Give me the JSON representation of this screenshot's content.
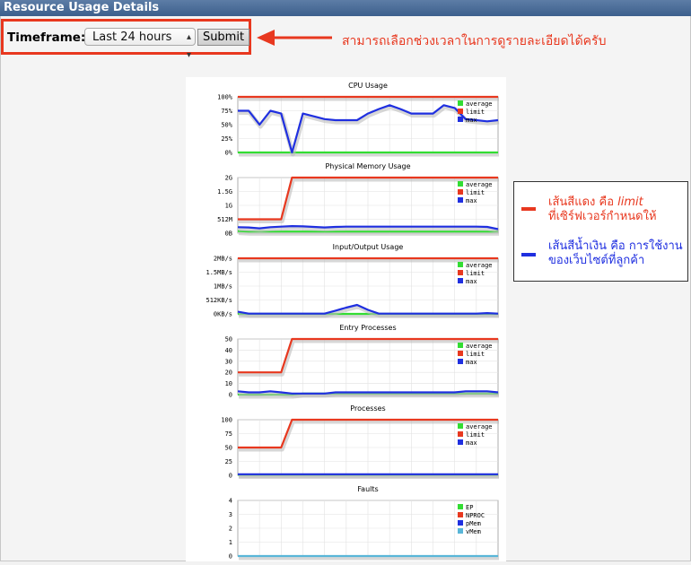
{
  "title": "Resource Usage Details",
  "timeframe": {
    "label": "Timeframe:",
    "selected": "Last 24 hours",
    "submit_label": "Submit"
  },
  "annotations": {
    "top_note": "สามารถเลือกช่วงเวลาในการดูรายละเอียดได้ครับ",
    "legend_red_line1_prefix": "เส้นสีแดง คือ ",
    "legend_red_line1_em": "limit",
    "legend_red_line2": "ที่เซิร์ฟเวอร์กำหนดให้",
    "legend_blue_line1": "เส้นสีน้ำเงิน คือ การใช้งาน",
    "legend_blue_line2": "ของเว็บไซต์ที่ลูกค้า",
    "red_color": "#e8381f",
    "blue_color": "#1f2fe0"
  },
  "chart_data": [
    {
      "type": "line",
      "title": "CPU Usage",
      "yticks": [
        "100%",
        "75%",
        "50%",
        "25%",
        "0%"
      ],
      "ylim": [
        0,
        100
      ],
      "legend": [
        "average",
        "limit",
        "max"
      ],
      "series": [
        {
          "name": "average",
          "color": "#33dd33",
          "values": [
            0,
            0,
            0,
            0,
            0,
            0,
            0,
            0,
            0,
            0,
            0,
            0,
            0,
            0,
            0,
            0,
            0,
            0,
            0,
            0,
            0,
            0,
            0,
            0,
            0
          ]
        },
        {
          "name": "limit",
          "color": "#e8381f",
          "values": [
            100,
            100,
            100,
            100,
            100,
            100,
            100,
            100,
            100,
            100,
            100,
            100,
            100,
            100,
            100,
            100,
            100,
            100,
            100,
            100,
            100,
            100,
            100,
            100,
            100
          ]
        },
        {
          "name": "max",
          "color": "#1f2fe0",
          "values": [
            75,
            75,
            50,
            75,
            70,
            0,
            70,
            65,
            60,
            58,
            58,
            58,
            70,
            78,
            85,
            78,
            70,
            70,
            70,
            85,
            80,
            60,
            58,
            56,
            58
          ]
        }
      ]
    },
    {
      "type": "line",
      "title": "Physical Memory Usage",
      "yticks": [
        "2G",
        "1.5G",
        "1G",
        "512M",
        "0B"
      ],
      "ylim": [
        0,
        2048
      ],
      "legend": [
        "average",
        "limit",
        "max"
      ],
      "series": [
        {
          "name": "average",
          "color": "#33dd33",
          "values": [
            80,
            60,
            60,
            60,
            60,
            60,
            60,
            60,
            60,
            60,
            60,
            60,
            60,
            60,
            60,
            60,
            60,
            60,
            60,
            60,
            60,
            60,
            60,
            60,
            60
          ]
        },
        {
          "name": "limit",
          "color": "#e8381f",
          "values": [
            512,
            512,
            512,
            512,
            512,
            2048,
            2048,
            2048,
            2048,
            2048,
            2048,
            2048,
            2048,
            2048,
            2048,
            2048,
            2048,
            2048,
            2048,
            2048,
            2048,
            2048,
            2048,
            2048,
            2048
          ]
        },
        {
          "name": "max",
          "color": "#1f2fe0",
          "values": [
            220,
            210,
            180,
            220,
            240,
            260,
            250,
            230,
            210,
            230,
            240,
            240,
            240,
            240,
            240,
            240,
            240,
            240,
            240,
            240,
            240,
            240,
            240,
            230,
            150
          ]
        }
      ]
    },
    {
      "type": "line",
      "title": "Input/Output Usage",
      "yticks": [
        "2MB/s",
        "1.5MB/s",
        "1MB/s",
        "512KB/s",
        "0KB/s"
      ],
      "ylim": [
        0,
        2048
      ],
      "legend": [
        "average",
        "limit",
        "max"
      ],
      "series": [
        {
          "name": "average",
          "color": "#33dd33",
          "values": [
            0,
            0,
            0,
            0,
            0,
            0,
            0,
            0,
            0,
            0,
            0,
            0,
            0,
            0,
            0,
            0,
            0,
            0,
            0,
            0,
            0,
            0,
            0,
            0,
            0
          ]
        },
        {
          "name": "limit",
          "color": "#e8381f",
          "values": [
            2048,
            2048,
            2048,
            2048,
            2048,
            2048,
            2048,
            2048,
            2048,
            2048,
            2048,
            2048,
            2048,
            2048,
            2048,
            2048,
            2048,
            2048,
            2048,
            2048,
            2048,
            2048,
            2048,
            2048,
            2048
          ]
        },
        {
          "name": "max",
          "color": "#1f2fe0",
          "values": [
            80,
            10,
            10,
            10,
            10,
            10,
            10,
            10,
            10,
            120,
            230,
            330,
            150,
            10,
            10,
            10,
            10,
            10,
            10,
            10,
            10,
            10,
            10,
            30,
            10
          ]
        }
      ]
    },
    {
      "type": "line",
      "title": "Entry Processes",
      "yticks": [
        "50",
        "40",
        "30",
        "20",
        "10",
        "0"
      ],
      "ylim": [
        0,
        50
      ],
      "legend": [
        "average",
        "limit",
        "max"
      ],
      "series": [
        {
          "name": "average",
          "color": "#33dd33",
          "values": [
            0,
            0,
            0,
            0,
            0,
            0,
            1,
            1,
            1,
            1,
            1,
            1,
            1,
            1,
            1,
            1,
            1,
            1,
            1,
            1,
            1,
            1,
            1,
            1,
            1
          ]
        },
        {
          "name": "limit",
          "color": "#e8381f",
          "values": [
            20,
            20,
            20,
            20,
            20,
            50,
            50,
            50,
            50,
            50,
            50,
            50,
            50,
            50,
            50,
            50,
            50,
            50,
            50,
            50,
            50,
            50,
            50,
            50,
            50
          ]
        },
        {
          "name": "max",
          "color": "#1f2fe0",
          "values": [
            3,
            2,
            2,
            3,
            2,
            1,
            1,
            1,
            1,
            2,
            2,
            2,
            2,
            2,
            2,
            2,
            2,
            2,
            2,
            2,
            2,
            3,
            3,
            3,
            2
          ]
        }
      ]
    },
    {
      "type": "line",
      "title": "Processes",
      "yticks": [
        "100",
        "75",
        "50",
        "25",
        "0"
      ],
      "ylim": [
        0,
        100
      ],
      "legend": [
        "average",
        "limit",
        "max"
      ],
      "series": [
        {
          "name": "average",
          "color": "#33dd33",
          "values": [
            1,
            1,
            1,
            1,
            1,
            1,
            1,
            1,
            1,
            1,
            1,
            1,
            1,
            1,
            1,
            1,
            1,
            1,
            1,
            1,
            1,
            1,
            1,
            1,
            1
          ]
        },
        {
          "name": "limit",
          "color": "#e8381f",
          "values": [
            50,
            50,
            50,
            50,
            50,
            100,
            100,
            100,
            100,
            100,
            100,
            100,
            100,
            100,
            100,
            100,
            100,
            100,
            100,
            100,
            100,
            100,
            100,
            100,
            100
          ]
        },
        {
          "name": "max",
          "color": "#1f2fe0",
          "values": [
            2,
            2,
            2,
            2,
            2,
            2,
            2,
            2,
            2,
            2,
            2,
            2,
            2,
            2,
            2,
            2,
            2,
            2,
            2,
            2,
            2,
            2,
            2,
            2,
            2
          ]
        }
      ]
    },
    {
      "type": "line",
      "title": "Faults",
      "yticks": [
        "4",
        "3",
        "2",
        "1",
        "0"
      ],
      "ylim": [
        0,
        4
      ],
      "legend": [
        "EP",
        "NPROC",
        "pMem",
        "vMem"
      ],
      "legend_colors": [
        "#33dd33",
        "#e8381f",
        "#1f2fe0",
        "#59b6d8"
      ],
      "series": [
        {
          "name": "vMem",
          "color": "#59b6d8",
          "values": [
            0,
            0,
            0,
            0,
            0,
            0,
            0,
            0,
            0,
            0,
            0,
            0,
            0,
            0,
            0,
            0,
            0,
            0,
            0,
            0,
            0,
            0,
            0,
            0,
            0
          ]
        }
      ]
    }
  ]
}
